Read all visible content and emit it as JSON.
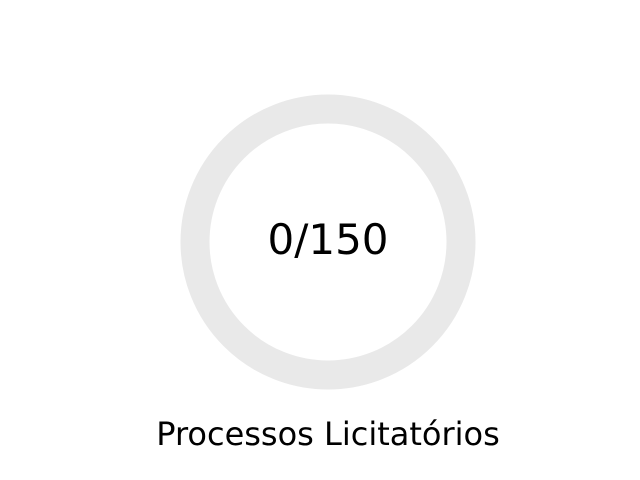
{
  "progress_widget": {
    "current": 0,
    "total": 150,
    "fraction": 0,
    "value_text": "0/150",
    "label": "Processos Licitatórios",
    "track_color": "#e9e9e9",
    "fill_color": "#4a90d9",
    "text_color": "#000000"
  }
}
